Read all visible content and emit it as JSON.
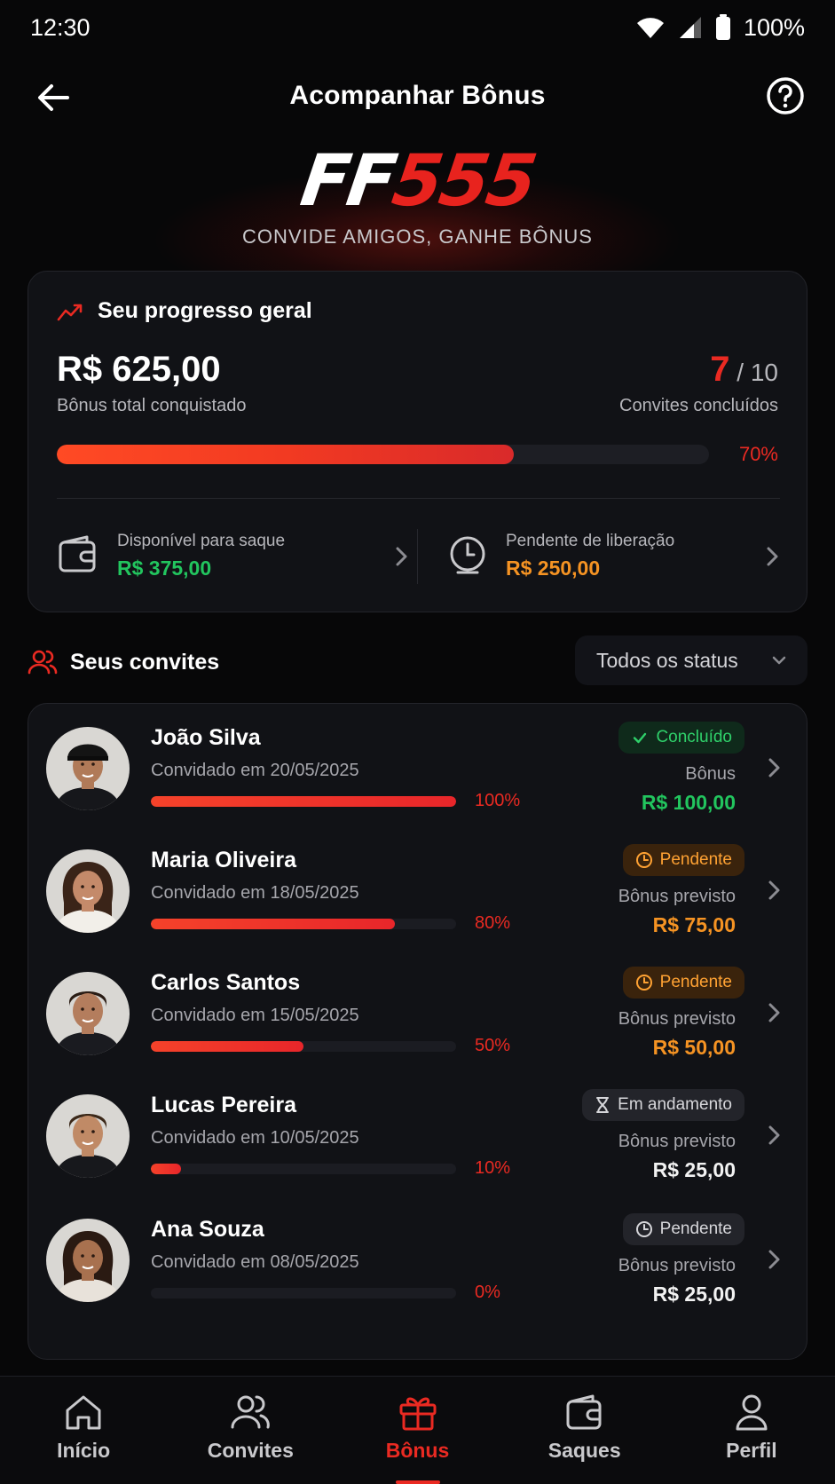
{
  "status_bar": {
    "time": "12:30",
    "battery": "100%"
  },
  "header": {
    "title": "Acompanhar Bônus"
  },
  "hero": {
    "logo_ff": "FF",
    "logo_num": "555",
    "tagline": "CONVIDE AMIGOS, GANHE BÔNUS"
  },
  "progress": {
    "title": "Seu progresso geral",
    "total_value": "R$ 625,00",
    "total_label": "Bônus total conquistado",
    "invites_done": "7",
    "invites_total": "/ 10",
    "invites_label": "Convites concluídos",
    "percent": "70%",
    "percent_value": 0.7,
    "available_label": "Disponível para saque",
    "available_value": "R$ 375,00",
    "pending_label": "Pendente de liberação",
    "pending_value": "R$ 250,00"
  },
  "invites_section": {
    "title": "Seus convites",
    "filter_label": "Todos os status"
  },
  "invites": [
    {
      "name": "João Silva",
      "date": "Convidado em 20/05/2025",
      "percent": "100%",
      "progress": 1.0,
      "status": "Concluído",
      "status_kind": "green",
      "bonus_label": "Bônus",
      "bonus_value": "R$ 100,00",
      "value_kind": "green"
    },
    {
      "name": "Maria Oliveira",
      "date": "Convidado em 18/05/2025",
      "percent": "80%",
      "progress": 0.8,
      "status": "Pendente",
      "status_kind": "orange",
      "bonus_label": "Bônus previsto",
      "bonus_value": "R$ 75,00",
      "value_kind": "orange"
    },
    {
      "name": "Carlos Santos",
      "date": "Convidado em 15/05/2025",
      "percent": "50%",
      "progress": 0.5,
      "status": "Pendente",
      "status_kind": "orange",
      "bonus_label": "Bônus previsto",
      "bonus_value": "R$ 50,00",
      "value_kind": "orange"
    },
    {
      "name": "Lucas Pereira",
      "date": "Convidado em 10/05/2025",
      "percent": "10%",
      "progress": 0.1,
      "status": "Em andamento",
      "status_kind": "gray",
      "bonus_label": "Bônus previsto",
      "bonus_value": "R$ 25,00",
      "value_kind": "white"
    },
    {
      "name": "Ana Souza",
      "date": "Convidado em 08/05/2025",
      "percent": "0%",
      "progress": 0.0,
      "status": "Pendente",
      "status_kind": "gray",
      "bonus_label": "Bônus previsto",
      "bonus_value": "R$ 25,00",
      "value_kind": "white"
    }
  ],
  "bottom_nav": [
    {
      "label": "Início",
      "icon": "home-icon"
    },
    {
      "label": "Convites",
      "icon": "users-icon"
    },
    {
      "label": "Bônus",
      "icon": "gift-icon",
      "active": true
    },
    {
      "label": "Saques",
      "icon": "wallet-icon"
    },
    {
      "label": "Perfil",
      "icon": "user-icon"
    }
  ],
  "colors": {
    "accent": "#ea2a22",
    "success": "#22c55e",
    "warning": "#f59323",
    "background": "#070708",
    "card": "#111216"
  }
}
